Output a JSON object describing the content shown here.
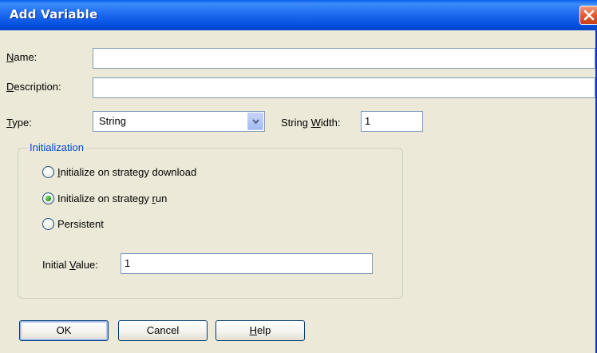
{
  "window": {
    "title": "Add Variable"
  },
  "fields": {
    "name": {
      "label": "Name:",
      "value": ""
    },
    "description": {
      "label": "Description:",
      "value": ""
    },
    "type": {
      "label": "Type:",
      "value": "String"
    },
    "string_width": {
      "label": "String Width:",
      "value": "1"
    }
  },
  "initialization": {
    "legend": "Initialization",
    "options": [
      {
        "label": "Initialize on strategy download",
        "selected": false
      },
      {
        "label": "Initialize on strategy run",
        "selected": true
      },
      {
        "label": "Persistent",
        "selected": false
      }
    ],
    "initial_value": {
      "label": "Initial Value:",
      "value": "1"
    }
  },
  "buttons": {
    "ok": "OK",
    "cancel": "Cancel",
    "help": "Help"
  },
  "colors": {
    "titlebar": "#0A5FEF",
    "close": "#E25B2F",
    "dialog_bg": "#ECE9D8",
    "group_legend": "#0046D5",
    "radio_dot": "#21A121"
  },
  "icons": {
    "close": "close-icon",
    "dropdown": "chevron-down-icon"
  }
}
